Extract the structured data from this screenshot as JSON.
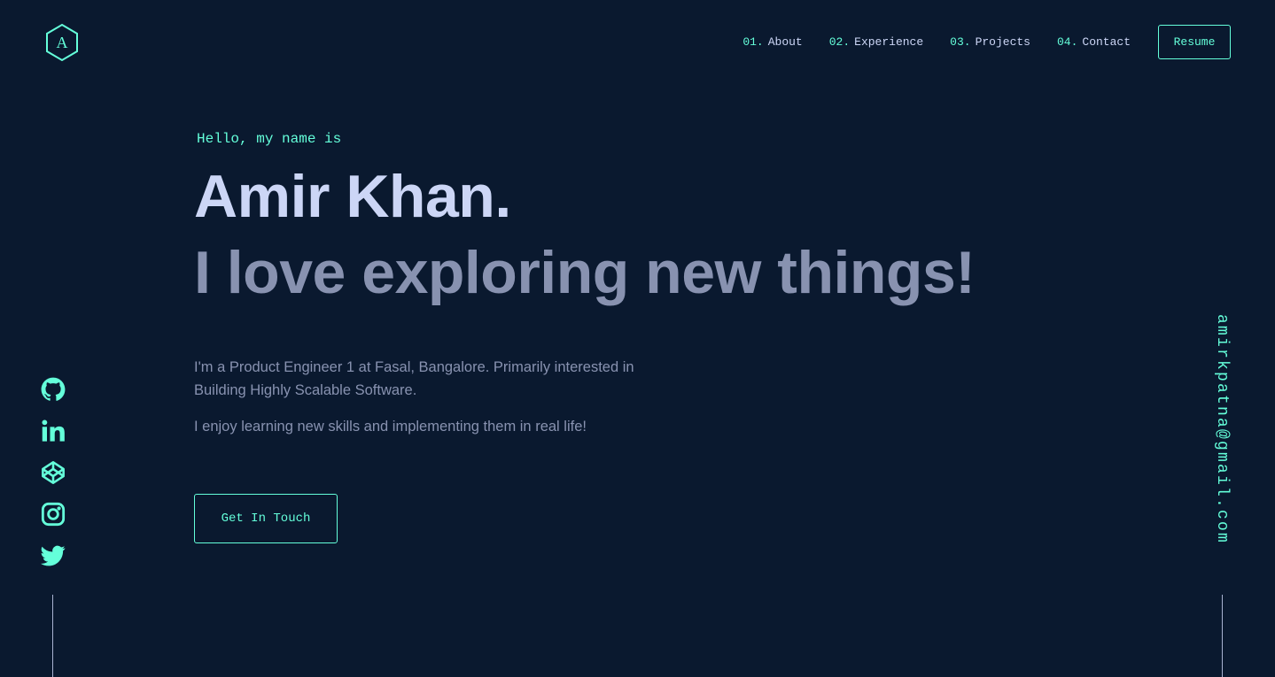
{
  "brand": {
    "logo_letter": "A",
    "accent": "#64ffda",
    "background": "#0a192f"
  },
  "nav": {
    "items": [
      {
        "num": "01.",
        "label": "About"
      },
      {
        "num": "02.",
        "label": "Experience"
      },
      {
        "num": "03.",
        "label": "Projects"
      },
      {
        "num": "04.",
        "label": "Contact"
      }
    ],
    "resume_label": "Resume"
  },
  "hero": {
    "greeting": "Hello, my name is",
    "name": "Amir Khan.",
    "tagline": "I love exploring new things!",
    "description": [
      "I'm a Product Engineer 1 at Fasal, Bangalore. Primarily interested in Building Highly Scalable Software.",
      "I enjoy learning new skills and implementing them in real life!"
    ],
    "cta_label": "Get In Touch"
  },
  "social": [
    "github-icon",
    "linkedin-icon",
    "codepen-icon",
    "instagram-icon",
    "twitter-icon"
  ],
  "email": "amirkpatna@gmail.com"
}
